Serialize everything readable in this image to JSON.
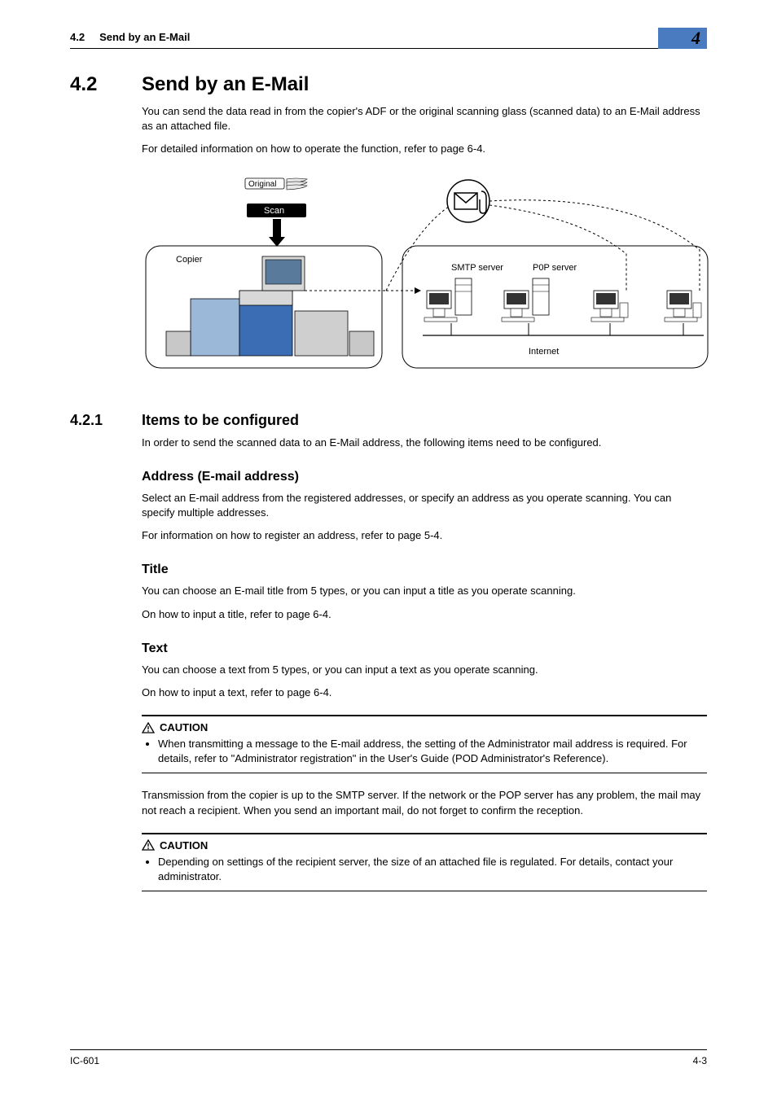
{
  "header": {
    "section_num": "4.2",
    "section_title_short": "Send by an E-Mail",
    "chapter_num": "4"
  },
  "section": {
    "num": "4.2",
    "title": "Send by an E-Mail",
    "intro_p1": "You can send the data read in from the copier's ADF or the original scanning glass (scanned data) to an E-Mail address as an attached file.",
    "intro_p2": "For detailed information on how to operate the function, refer to page 6-4."
  },
  "diagram": {
    "label_original": "Original",
    "label_scan": "Scan",
    "label_copier": "Copier",
    "label_smtp": "SMTP server",
    "label_pop": "P0P server",
    "label_internet": "Internet"
  },
  "subsection": {
    "num": "4.2.1",
    "title": "Items to be configured",
    "intro": "In order to send the scanned data to an E-Mail address, the following items need to be configured."
  },
  "address": {
    "head": "Address (E-mail address)",
    "p1": "Select an E-mail address from the registered addresses, or specify an address as you operate scanning. You can specify multiple addresses.",
    "p2": "For information on how to register an address, refer to page 5-4."
  },
  "titleblk": {
    "head": "Title",
    "p1": "You can choose an E-mail title from 5 types, or you can input a title as you operate scanning.",
    "p2": "On how to input a title, refer to page 6-4."
  },
  "textblk": {
    "head": "Text",
    "p1": "You can choose a text from 5 types, or you can input a text as you operate scanning.",
    "p2": "On how to input a text, refer to page 6-4."
  },
  "caution1": {
    "label": "CAUTION",
    "text": "When transmitting a message to the E-mail address, the setting of the Administrator mail address is required.  For details, refer to \"Administrator registration\" in the User's Guide (POD Administrator's Reference)."
  },
  "mid_p": "Transmission from the copier is up to the SMTP server.  If the network or the POP server has any problem, the mail may not reach a recipient.  When you send an important mail, do not forget to confirm the reception.",
  "caution2": {
    "label": "CAUTION",
    "text": "Depending on settings of the recipient server, the size of an attached file is regulated.  For details, contact your administrator."
  },
  "footer": {
    "model": "IC-601",
    "page": "4-3"
  }
}
